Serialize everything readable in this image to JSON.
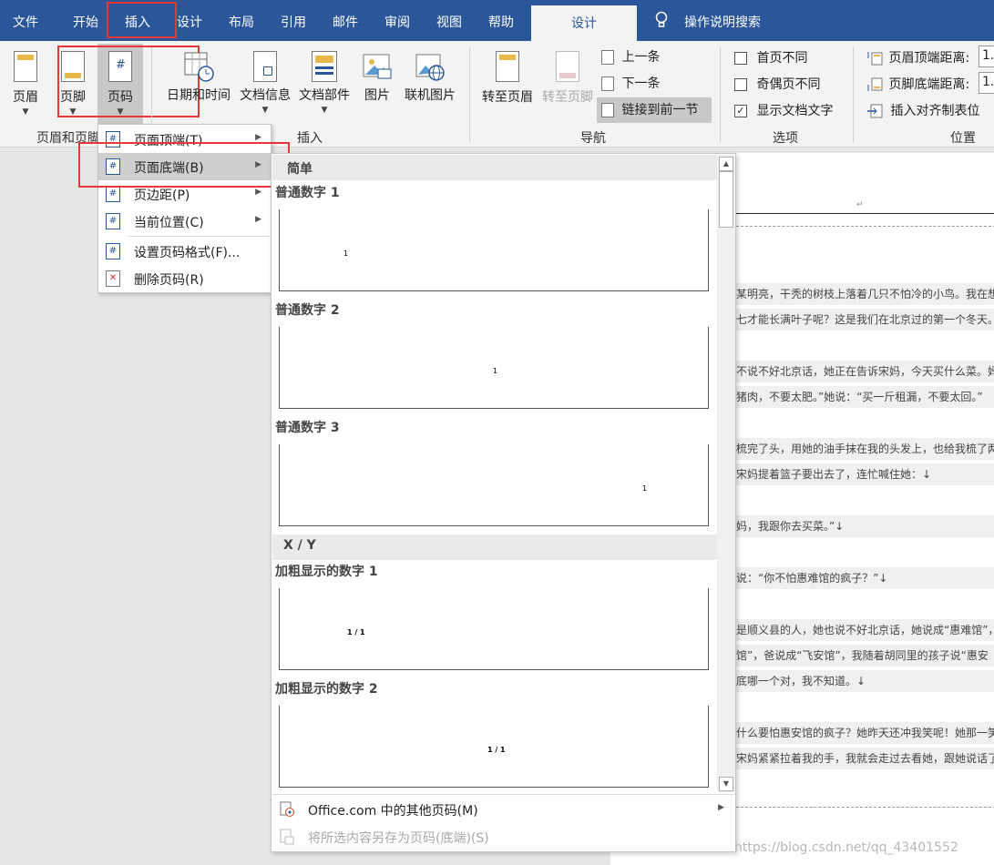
{
  "tabs": [
    "文件",
    "开始",
    "插入",
    "设计",
    "布局",
    "引用",
    "邮件",
    "审阅",
    "视图",
    "帮助"
  ],
  "active_context_tab": "设计",
  "search": "操作说明搜索",
  "ribbon": {
    "header": "页眉",
    "footer": "页脚",
    "page_number": "页码",
    "datetime": "日期和时间",
    "docinfo": "文档信息",
    "quickparts": "文档部件",
    "picture": "图片",
    "online_picture": "联机图片",
    "goto_header": "转至页眉",
    "goto_footer": "转至页脚",
    "previous": "上一条",
    "next": "下一条",
    "link_previous": "链接到前一节",
    "first_page_diff": "首页不同",
    "odd_even_diff": "奇偶页不同",
    "show_doc_text": "显示文档文字",
    "header_from_top": "页眉顶端距离:",
    "footer_from_bottom": "页脚底端距离:",
    "header_value": "1.",
    "footer_value": "1.",
    "insert_align_tab": "插入对齐制表位",
    "groups": {
      "header_footer": "页眉和页脚",
      "insert": "插入",
      "navigation": "导航",
      "options": "选项",
      "position": "位置"
    }
  },
  "menu": [
    {
      "label": "页面顶端(T)",
      "submenu": true
    },
    {
      "label": "页面底端(B)",
      "submenu": true
    },
    {
      "label": "页边距(P)",
      "submenu": true
    },
    {
      "label": "当前位置(C)",
      "submenu": true
    },
    {
      "label": "设置页码格式(F)...",
      "submenu": false
    },
    {
      "label": "删除页码(R)",
      "submenu": false
    }
  ],
  "gallery": {
    "section_simple": "简单",
    "section_xy": "X / Y",
    "items": [
      {
        "label": "普通数字 1",
        "sample": "1"
      },
      {
        "label": "普通数字 2",
        "sample": "1"
      },
      {
        "label": "普通数字 3",
        "sample": "1"
      },
      {
        "label": "加粗显示的数字 1",
        "sample": "1 / 1"
      },
      {
        "label": "加粗显示的数字 2",
        "sample": "1 / 1"
      }
    ],
    "more": "Office.com 中的其他页码(M)",
    "save_selection": "将所选内容另存为页码(底端)(S)"
  },
  "document": {
    "lines": [
      "某明亮，干秃的树枝上落着几只不怕冷的小鸟。我在想，",
      "七才能长满叶子呢？这是我们在北京过的第一个冬天。↓",
      "不说不好北京话，她正在告诉宋妈，今天买什么菜。妈不",
      "猪肉，不要太肥。”她说：“买一斤租漏，不要太回。”",
      "梳完了头，用她的油手抹在我的头发上，也给我梳了两条",
      "宋妈提着篮子要出去了，连忙喊住她：↓",
      "妈，我跟你去买菜。”↓",
      "说：“你不怕惠难馆的疯子？”↓",
      "是顺义县的人，她也说不好北京话，她说成“惠难馆”，",
      "馆”，爸说成“飞安馆”，我随着胡同里的孩子说“惠安",
      "底哪一个对，我不知道。↓",
      "什么要怕惠安馆的疯子？她昨天还冲我笑呢！她那一笑真",
      "宋妈紧紧拉着我的手，我就会走过去看她，跟她说话了。"
    ]
  },
  "watermark": "https://blog.csdn.net/qq_43401552"
}
